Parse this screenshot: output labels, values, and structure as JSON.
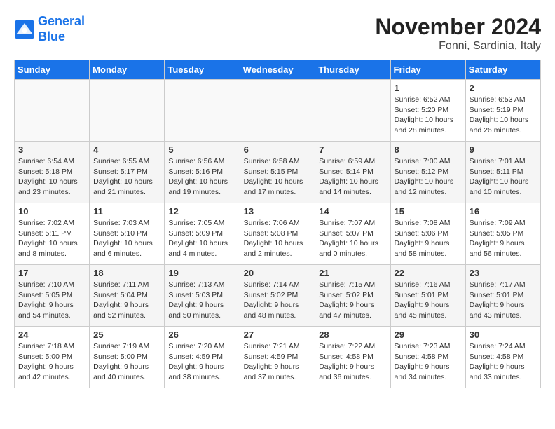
{
  "header": {
    "logo_line1": "General",
    "logo_line2": "Blue",
    "month": "November 2024",
    "location": "Fonni, Sardinia, Italy"
  },
  "weekdays": [
    "Sunday",
    "Monday",
    "Tuesday",
    "Wednesday",
    "Thursday",
    "Friday",
    "Saturday"
  ],
  "weeks": [
    [
      {
        "day": "",
        "info": ""
      },
      {
        "day": "",
        "info": ""
      },
      {
        "day": "",
        "info": ""
      },
      {
        "day": "",
        "info": ""
      },
      {
        "day": "",
        "info": ""
      },
      {
        "day": "1",
        "info": "Sunrise: 6:52 AM\nSunset: 5:20 PM\nDaylight: 10 hours and 28 minutes."
      },
      {
        "day": "2",
        "info": "Sunrise: 6:53 AM\nSunset: 5:19 PM\nDaylight: 10 hours and 26 minutes."
      }
    ],
    [
      {
        "day": "3",
        "info": "Sunrise: 6:54 AM\nSunset: 5:18 PM\nDaylight: 10 hours and 23 minutes."
      },
      {
        "day": "4",
        "info": "Sunrise: 6:55 AM\nSunset: 5:17 PM\nDaylight: 10 hours and 21 minutes."
      },
      {
        "day": "5",
        "info": "Sunrise: 6:56 AM\nSunset: 5:16 PM\nDaylight: 10 hours and 19 minutes."
      },
      {
        "day": "6",
        "info": "Sunrise: 6:58 AM\nSunset: 5:15 PM\nDaylight: 10 hours and 17 minutes."
      },
      {
        "day": "7",
        "info": "Sunrise: 6:59 AM\nSunset: 5:14 PM\nDaylight: 10 hours and 14 minutes."
      },
      {
        "day": "8",
        "info": "Sunrise: 7:00 AM\nSunset: 5:12 PM\nDaylight: 10 hours and 12 minutes."
      },
      {
        "day": "9",
        "info": "Sunrise: 7:01 AM\nSunset: 5:11 PM\nDaylight: 10 hours and 10 minutes."
      }
    ],
    [
      {
        "day": "10",
        "info": "Sunrise: 7:02 AM\nSunset: 5:11 PM\nDaylight: 10 hours and 8 minutes."
      },
      {
        "day": "11",
        "info": "Sunrise: 7:03 AM\nSunset: 5:10 PM\nDaylight: 10 hours and 6 minutes."
      },
      {
        "day": "12",
        "info": "Sunrise: 7:05 AM\nSunset: 5:09 PM\nDaylight: 10 hours and 4 minutes."
      },
      {
        "day": "13",
        "info": "Sunrise: 7:06 AM\nSunset: 5:08 PM\nDaylight: 10 hours and 2 minutes."
      },
      {
        "day": "14",
        "info": "Sunrise: 7:07 AM\nSunset: 5:07 PM\nDaylight: 10 hours and 0 minutes."
      },
      {
        "day": "15",
        "info": "Sunrise: 7:08 AM\nSunset: 5:06 PM\nDaylight: 9 hours and 58 minutes."
      },
      {
        "day": "16",
        "info": "Sunrise: 7:09 AM\nSunset: 5:05 PM\nDaylight: 9 hours and 56 minutes."
      }
    ],
    [
      {
        "day": "17",
        "info": "Sunrise: 7:10 AM\nSunset: 5:05 PM\nDaylight: 9 hours and 54 minutes."
      },
      {
        "day": "18",
        "info": "Sunrise: 7:11 AM\nSunset: 5:04 PM\nDaylight: 9 hours and 52 minutes."
      },
      {
        "day": "19",
        "info": "Sunrise: 7:13 AM\nSunset: 5:03 PM\nDaylight: 9 hours and 50 minutes."
      },
      {
        "day": "20",
        "info": "Sunrise: 7:14 AM\nSunset: 5:02 PM\nDaylight: 9 hours and 48 minutes."
      },
      {
        "day": "21",
        "info": "Sunrise: 7:15 AM\nSunset: 5:02 PM\nDaylight: 9 hours and 47 minutes."
      },
      {
        "day": "22",
        "info": "Sunrise: 7:16 AM\nSunset: 5:01 PM\nDaylight: 9 hours and 45 minutes."
      },
      {
        "day": "23",
        "info": "Sunrise: 7:17 AM\nSunset: 5:01 PM\nDaylight: 9 hours and 43 minutes."
      }
    ],
    [
      {
        "day": "24",
        "info": "Sunrise: 7:18 AM\nSunset: 5:00 PM\nDaylight: 9 hours and 42 minutes."
      },
      {
        "day": "25",
        "info": "Sunrise: 7:19 AM\nSunset: 5:00 PM\nDaylight: 9 hours and 40 minutes."
      },
      {
        "day": "26",
        "info": "Sunrise: 7:20 AM\nSunset: 4:59 PM\nDaylight: 9 hours and 38 minutes."
      },
      {
        "day": "27",
        "info": "Sunrise: 7:21 AM\nSunset: 4:59 PM\nDaylight: 9 hours and 37 minutes."
      },
      {
        "day": "28",
        "info": "Sunrise: 7:22 AM\nSunset: 4:58 PM\nDaylight: 9 hours and 36 minutes."
      },
      {
        "day": "29",
        "info": "Sunrise: 7:23 AM\nSunset: 4:58 PM\nDaylight: 9 hours and 34 minutes."
      },
      {
        "day": "30",
        "info": "Sunrise: 7:24 AM\nSunset: 4:58 PM\nDaylight: 9 hours and 33 minutes."
      }
    ]
  ]
}
